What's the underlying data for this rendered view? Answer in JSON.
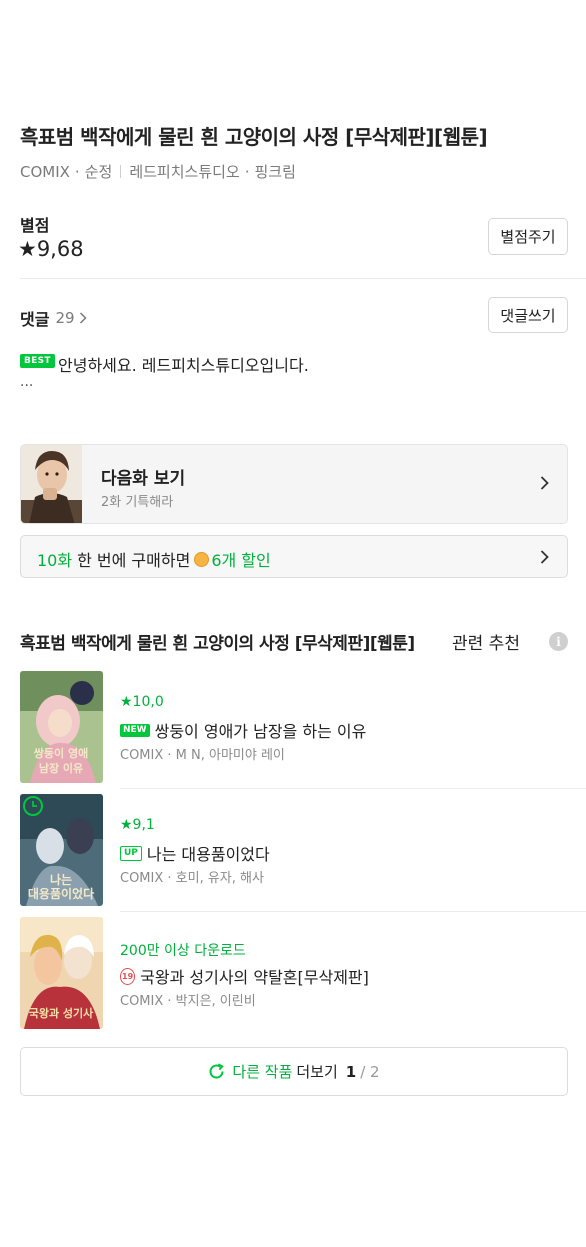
{
  "title": "흑표범 백작에게 물린 흰 고양이의 사정 [무삭제판][웹툰]",
  "meta": {
    "publisher": "COMIX",
    "genre": "순정",
    "authors": "레드피치스튜디오",
    "artist": "핑크림"
  },
  "rating": {
    "label": "별점",
    "value": "★9,68",
    "button": "별점주기"
  },
  "comments": {
    "label": "댓글",
    "count": "29",
    "button": "댓글쓰기",
    "best_badge": "BEST",
    "best_text": "안녕하세요. 레드피치스튜디오입니다.",
    "more": "..."
  },
  "next_episode": {
    "title": "다음화 보기",
    "subtitle": "2화 기특해라"
  },
  "promo": {
    "highlight": "10화",
    "text": "한 번에 구매하면",
    "discount": "6개 할인"
  },
  "recommend": {
    "title": "흑표범 백작에게 물린 흰 고양이의 사정 [무삭제판][웹툰]",
    "suffix": "관련 추천",
    "items": [
      {
        "badge": "★10,0",
        "tag": "NEW",
        "name": "쌍둥이 영애가 남장을 하는 이유",
        "meta": "COMIX · M N, 아마미야 레이"
      },
      {
        "badge": "★9,1",
        "tag": "UP",
        "name": "나는 대용품이었다",
        "meta": "COMIX · 호미, 유자, 해사"
      },
      {
        "badge": "200만 이상 다운로드",
        "tag": "19",
        "name": "국왕과 성기사의 약탈혼[무삭제판]",
        "meta": "COMIX · 박지은, 이린비"
      }
    ]
  },
  "more_button": {
    "label_green": "다른 작품",
    "label": "더보기",
    "page": "1",
    "total": "/ 2"
  },
  "colors": {
    "accent": "#00c73c",
    "adult_tag": "#e84c4c"
  }
}
